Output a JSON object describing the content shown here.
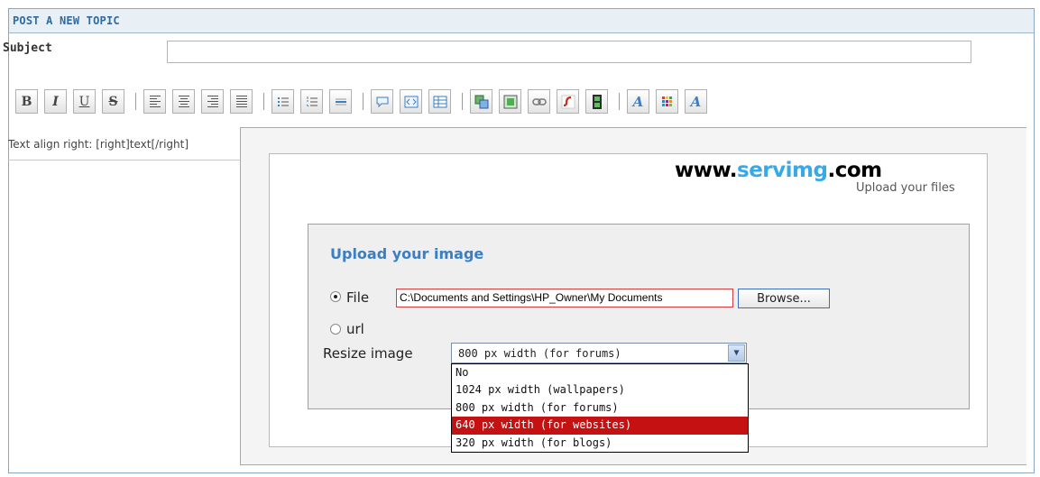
{
  "header": {
    "title": "POST A NEW TOPIC"
  },
  "subject": {
    "label": "Subject",
    "value": ""
  },
  "toolbar": {
    "buttons": [
      {
        "name": "bold-button",
        "icon": "bold-icon",
        "glyph": "B"
      },
      {
        "name": "italic-button",
        "icon": "italic-icon",
        "glyph": "I"
      },
      {
        "name": "underline-button",
        "icon": "underline-icon",
        "glyph": "U"
      },
      {
        "name": "strikethrough-button",
        "icon": "strikethrough-icon",
        "glyph": "S"
      },
      {
        "name": "align-left-button",
        "icon": "align-left-icon"
      },
      {
        "name": "align-center-button",
        "icon": "align-center-icon"
      },
      {
        "name": "align-right-button",
        "icon": "align-right-icon"
      },
      {
        "name": "justify-button",
        "icon": "justify-icon"
      },
      {
        "name": "bullet-list-button",
        "icon": "bullet-list-icon"
      },
      {
        "name": "numbered-list-button",
        "icon": "numbered-list-icon"
      },
      {
        "name": "horizontal-rule-button",
        "icon": "horizontal-rule-icon"
      },
      {
        "name": "quote-button",
        "icon": "quote-icon"
      },
      {
        "name": "code-button",
        "icon": "code-icon"
      },
      {
        "name": "table-button",
        "icon": "table-icon"
      },
      {
        "name": "host-image-button",
        "icon": "host-image-icon"
      },
      {
        "name": "image-button",
        "icon": "image-icon"
      },
      {
        "name": "link-button",
        "icon": "link-icon"
      },
      {
        "name": "flash-button",
        "icon": "flash-icon"
      },
      {
        "name": "video-button",
        "icon": "video-icon"
      },
      {
        "name": "font-size-button",
        "icon": "font-size-icon"
      },
      {
        "name": "color-button",
        "icon": "color-palette-icon"
      },
      {
        "name": "font-face-button",
        "icon": "font-face-icon"
      }
    ]
  },
  "editor": {
    "hint": "Text align right: [right]text[/right]"
  },
  "servimg": {
    "logo_left": "www.",
    "logo_brand": "servimg",
    "logo_right": ".com",
    "tagline": "Upload your files",
    "upload_title": "Upload your image",
    "file_label": "File",
    "url_label": "url",
    "file_path": "C:\\Documents and Settings\\HP_Owner\\My Documents",
    "browse_label": "Browse...",
    "resize_label": "Resize image",
    "resize_value": "800 px width (for forums)",
    "resize_options": [
      "No",
      "1024 px width (wallpapers)",
      "800 px width (for forums)",
      "640 px width (for websites)",
      "320 px width (for blogs)"
    ],
    "highlighted_option": "640 px width (for websites)",
    "selected_radio": "file"
  },
  "colors": {
    "title": "#2f6aa3",
    "upload_title": "#3a7fc4",
    "logo_accent": "#39a8e8",
    "dropdown_highlight": "#c51111"
  }
}
